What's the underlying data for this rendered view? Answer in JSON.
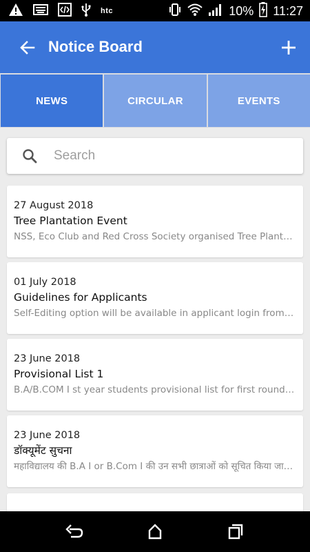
{
  "status_bar": {
    "carrier": "htc",
    "battery": "10%",
    "time": "11:27",
    "icons": [
      "warning-icon",
      "keyboard-icon",
      "code-icon",
      "usb-icon",
      "vibrate-icon",
      "wifi-icon",
      "signal-icon",
      "battery-charging-icon"
    ]
  },
  "app_bar": {
    "title": "Notice Board",
    "back_icon": "arrow-back-icon",
    "add_icon": "plus-icon",
    "color": "#3b75d9"
  },
  "tabs": [
    {
      "label": "NEWS",
      "active": true
    },
    {
      "label": "CIRCULAR",
      "active": false
    },
    {
      "label": "EVENTS",
      "active": false
    }
  ],
  "search": {
    "placeholder": "Search",
    "value": ""
  },
  "notices": [
    {
      "date": "27 August 2018",
      "title": "Tree Plantation Event",
      "description": "NSS, Eco Club and Red Cross Society organised Tree Plantation Event in the college campus"
    },
    {
      "date": "01 July 2018",
      "title": "Guidelines for Applicants",
      "description": "Self-Editing option will be available in applicant login from the portal"
    },
    {
      "date": "23 June 2018",
      "title": "Provisional List 1",
      "description": "B.A/B.COM I st year students provisional list for first round of admission"
    },
    {
      "date": "23 June 2018",
      "title": "डॉक्यूमेंट सुचना",
      "description": "महाविद्यालय की B.A I or B.Com I की उन सभी छात्राओं को सूचित किया जाता है"
    }
  ],
  "nav_bar": {
    "icons": [
      "back-nav-icon",
      "home-nav-icon",
      "recents-nav-icon"
    ]
  }
}
